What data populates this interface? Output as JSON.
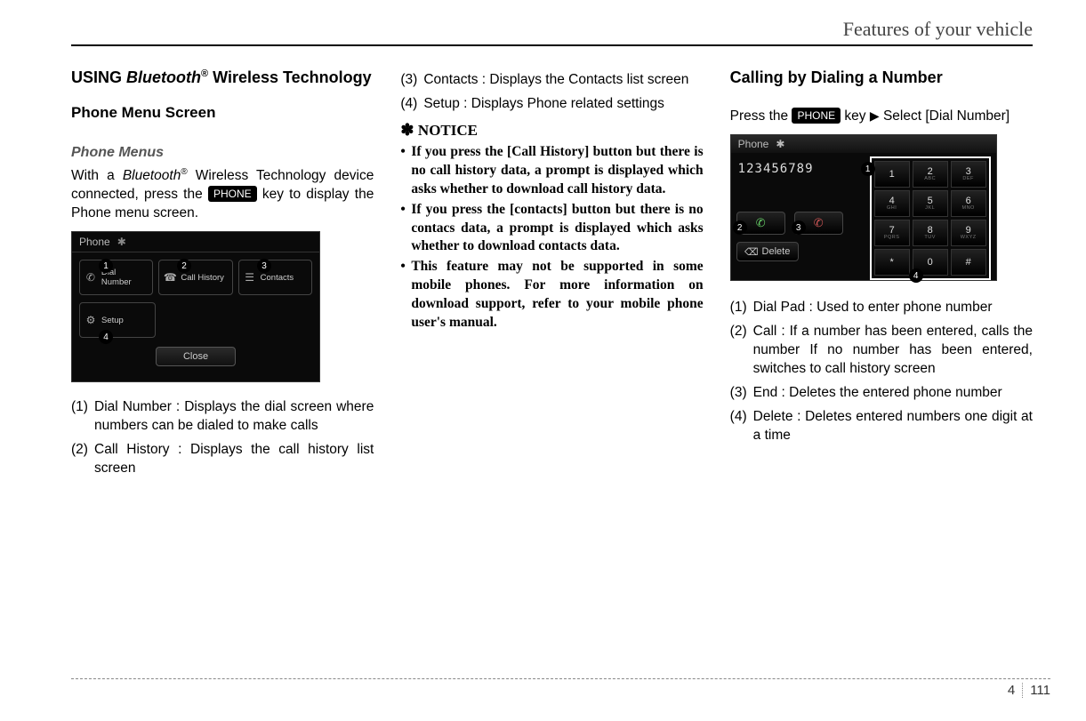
{
  "header": {
    "title": "Features of your vehicle"
  },
  "col1": {
    "title_pre": "USING ",
    "title_bt": "Bluetooth",
    "title_reg": "®",
    "title_post": "  Wireless Technology",
    "sub1": "Phone Menu Screen",
    "sub2": "Phone Menus",
    "para1_a": "With a ",
    "para1_bt": "Bluetooth",
    "para1_reg": "®",
    "para1_b": " Wireless Technology device connected, press the ",
    "phone_key": "PHONE",
    "para1_c": " key to display the Phone menu screen.",
    "shot": {
      "title": "Phone",
      "items": [
        "Dial Number",
        "Call History",
        "Contacts",
        "Setup"
      ],
      "close": "Close",
      "callouts": [
        "1",
        "2",
        "3",
        "4"
      ]
    },
    "list": [
      {
        "n": "(1)",
        "t": "Dial Number : Displays the dial screen where numbers can be dialed to make calls"
      },
      {
        "n": "(2)",
        "t": "Call History : Displays the call history list screen"
      }
    ]
  },
  "col2": {
    "list": [
      {
        "n": "(3)",
        "t": "Contacts : Displays the Contacts list screen"
      },
      {
        "n": "(4)",
        "t": "Setup : Displays Phone related settings"
      }
    ],
    "notice_head": "NOTICE",
    "notice": [
      "If you press the [Call History] button but there is no call history data, a prompt is displayed which asks whether to download call history data.",
      "If you press the [contacts] button but there is no contacs data, a prompt is displayed which asks whether to download contacts data.",
      "This feature may not be supported in some mobile phones. For more information on download support, refer to your mobile phone user's manual."
    ]
  },
  "col3": {
    "title": "Calling by Dialing a Number",
    "para_a": "Press the ",
    "phone_key": "PHONE",
    "para_b": " key",
    "arrow": "▶",
    "para_c": "Select [Dial Number]",
    "shot": {
      "title": "Phone",
      "display": "123456789",
      "delete": "Delete",
      "keys": [
        {
          "m": "1",
          "s": ""
        },
        {
          "m": "2",
          "s": "ABC"
        },
        {
          "m": "3",
          "s": "DEF"
        },
        {
          "m": "4",
          "s": "GHI"
        },
        {
          "m": "5",
          "s": "JKL"
        },
        {
          "m": "6",
          "s": "MNO"
        },
        {
          "m": "7",
          "s": "PQRS"
        },
        {
          "m": "8",
          "s": "TUV"
        },
        {
          "m": "9",
          "s": "WXYZ"
        },
        {
          "m": "*",
          "s": ""
        },
        {
          "m": "0",
          "s": ""
        },
        {
          "m": "#",
          "s": ""
        }
      ],
      "callouts": [
        "1",
        "2",
        "3",
        "4"
      ]
    },
    "list": [
      {
        "n": "(1)",
        "t": "Dial Pad : Used to enter phone number"
      },
      {
        "n": "(2)",
        "t": "Call : If a number has been entered, calls the number If no number has been entered, switches to call history screen"
      },
      {
        "n": "(3)",
        "t": "End : Deletes the entered phone number"
      },
      {
        "n": "(4)",
        "t": "Delete : Deletes entered numbers one digit at a time"
      }
    ]
  },
  "footer": {
    "chapter": "4",
    "page": "111"
  }
}
